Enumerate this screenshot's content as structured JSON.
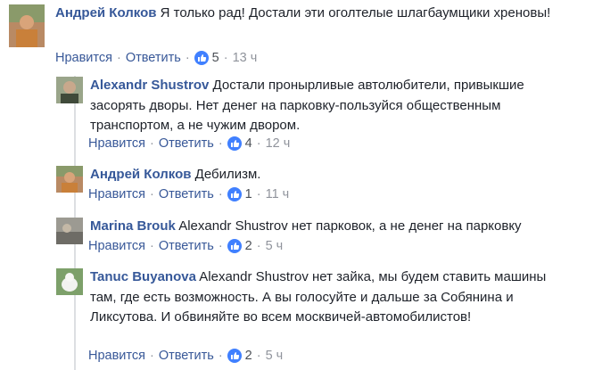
{
  "actions": {
    "like": "Нравится",
    "reply": "Ответить"
  },
  "comments": [
    {
      "author": "Андрей Колков",
      "text": "Я только рад! Достали эти оголтелые шлагбаумщики хреновы!",
      "likes": "5",
      "time": "13 ч",
      "avatar_color": "#c9956a"
    },
    {
      "author": "Alexandr Shustrov",
      "text": "Достали пронырливые автолюбители, привыкшие засорять дворы. Нет денег на парковку-пользуйся общественным транспортом, а не чужим двором.",
      "likes": "4",
      "time": "12 ч",
      "avatar_color": "#6f7f66"
    },
    {
      "author": "Андрей Колков",
      "text": "Дебилизм.",
      "likes": "1",
      "time": "11 ч",
      "avatar_color": "#c9956a"
    },
    {
      "author": "Marina Brouk",
      "text": "Alexandr Shustrov нет парковок, а не денег на парковку",
      "likes": "2",
      "time": "5 ч",
      "avatar_color": "#8c8a84"
    },
    {
      "author": "Tanuc Buyanova",
      "text": "Alexandr Shustrov нет зайка, мы будем ставить машины там, где есть возможность. А вы голосуйте и дальше за Собянина и Ликсутова. И обвиняйте во всем москвичей-автомобилистов!",
      "likes": "2",
      "time": "5 ч",
      "avatar_color": "#7da06a"
    }
  ],
  "colors": {
    "author": "#365899",
    "like_badge": "#4080ff",
    "meta": "#90949c"
  }
}
